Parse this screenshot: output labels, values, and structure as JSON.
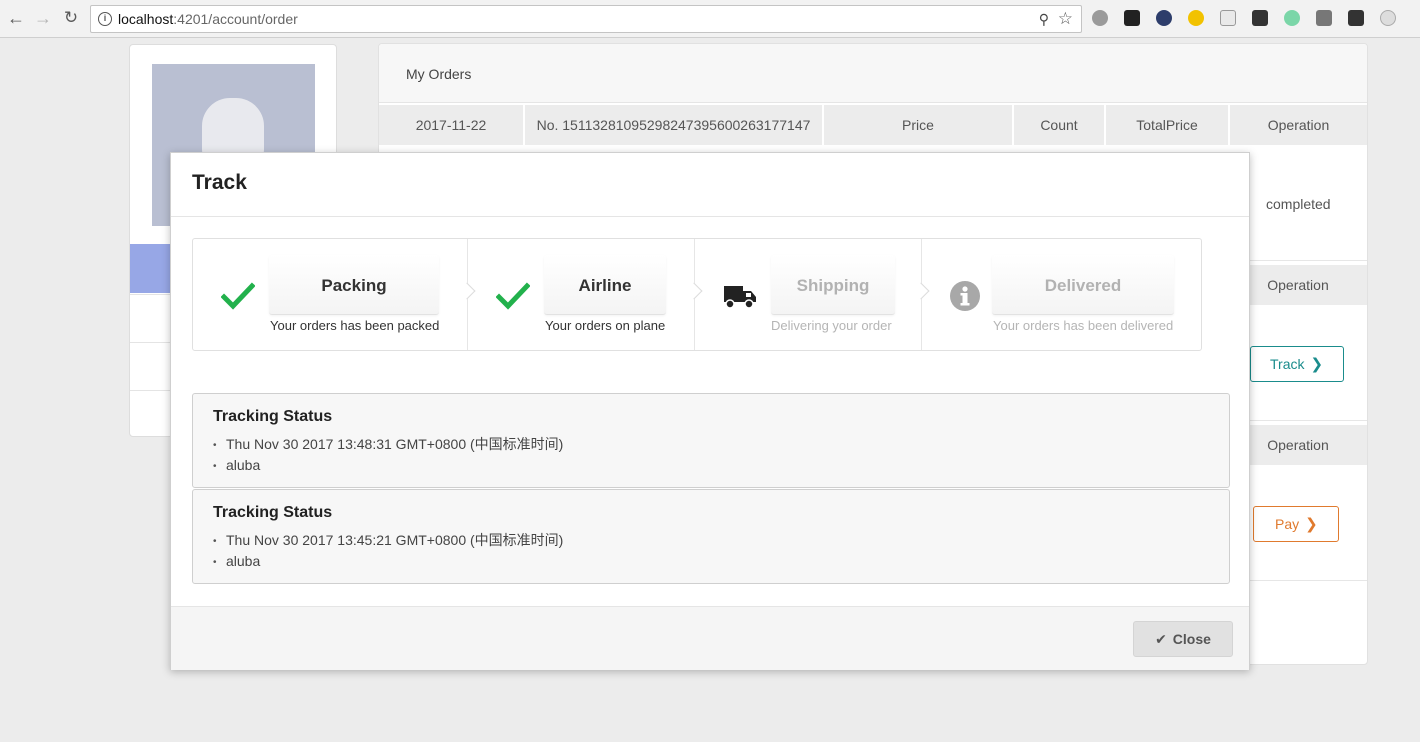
{
  "browser": {
    "url_host": "localhost",
    "url_path": ":4201/account/order"
  },
  "orders": {
    "title": "My Orders",
    "header": {
      "date": "2017-11-22",
      "number": "No. 15113281095298247395600263177147",
      "price": "Price",
      "count": "Count",
      "total": "TotalPrice",
      "operation": "Operation"
    },
    "row1_status": "completed",
    "op2": "Operation",
    "op3": "Operation",
    "track_label": "Track",
    "pay_label": "Pay"
  },
  "modal": {
    "title": "Track",
    "steps": [
      {
        "label": "Packing",
        "desc": "Your orders has been packed",
        "state": "done",
        "icon": "check-icon"
      },
      {
        "label": "Airline",
        "desc": "Your orders on plane",
        "state": "done",
        "icon": "check-icon"
      },
      {
        "label": "Shipping",
        "desc": "Delivering your order",
        "state": "pending",
        "icon": "truck-icon"
      },
      {
        "label": "Delivered",
        "desc": "Your orders has been delivered",
        "state": "pending",
        "icon": "info-icon"
      }
    ],
    "tracking": [
      {
        "heading": "Tracking Status",
        "time": "Thu Nov 30 2017 13:48:31 GMT+0800 (中国标准时间)",
        "note": "aluba"
      },
      {
        "heading": "Tracking Status",
        "time": "Thu Nov 30 2017 13:45:21 GMT+0800 (中国标准时间)",
        "note": "aluba"
      }
    ],
    "close_label": "Close"
  },
  "colors": {
    "check_green": "#22b14c",
    "track_teal": "#1a8c8c",
    "pay_orange": "#e07a2e",
    "menu_active": "#97a7e6"
  }
}
